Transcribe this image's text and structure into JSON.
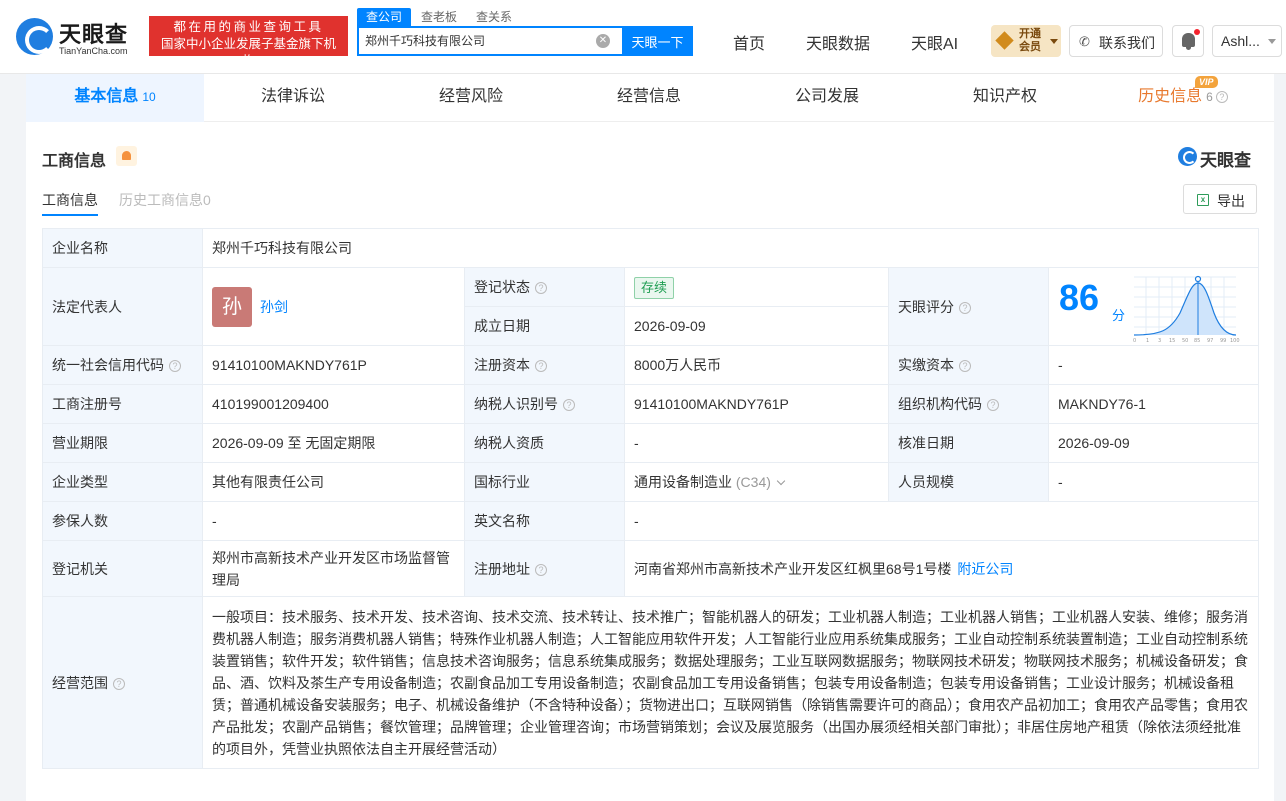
{
  "header": {
    "logo_name": "天眼查",
    "logo_url": "TianYanCha.com",
    "slogan_line1": "都在用的商业查询工具",
    "slogan_line2": "国家中小企业发展子基金旗下机构",
    "search_tabs": [
      "查公司",
      "查老板",
      "查关系"
    ],
    "search_value": "郑州千巧科技有限公司",
    "search_button": "天眼一下",
    "nav": [
      "首页",
      "天眼数据",
      "天眼AI"
    ],
    "vip_label": "开通会员",
    "contact_label": "联系我们",
    "user_name": "Ashl..."
  },
  "tabs": [
    {
      "label": "基本信息",
      "count": "10"
    },
    {
      "label": "法律诉讼"
    },
    {
      "label": "经营风险"
    },
    {
      "label": "经营信息"
    },
    {
      "label": "公司发展"
    },
    {
      "label": "知识产权"
    },
    {
      "label": "历史信息",
      "count": "6",
      "badge": "VIP"
    }
  ],
  "section": {
    "title": "工商信息",
    "brand": "天眼查",
    "sub_tabs": [
      "工商信息",
      "历史工商信息0"
    ],
    "export_label": "导出"
  },
  "info": {
    "company_name_label": "企业名称",
    "company_name": "郑州千巧科技有限公司",
    "legal_rep_label": "法定代表人",
    "legal_rep_avatar": "孙",
    "legal_rep": "孙剑",
    "reg_status_label": "登记状态",
    "reg_status": "存续",
    "founded_label": "成立日期",
    "founded": "2026-09-09",
    "score_label": "天眼评分",
    "score": "86",
    "score_unit": "分",
    "score_axis": [
      "0",
      "1",
      "3",
      "15",
      "50",
      "85",
      "97",
      "99",
      "100"
    ],
    "credit_code_label": "统一社会信用代码",
    "credit_code": "91410100MAKNDY761P",
    "reg_capital_label": "注册资本",
    "reg_capital": "8000万人民币",
    "paid_capital_label": "实缴资本",
    "paid_capital": "-",
    "reg_no_label": "工商注册号",
    "reg_no": "410199001209400",
    "taxpayer_id_label": "纳税人识别号",
    "taxpayer_id": "91410100MAKNDY761P",
    "org_code_label": "组织机构代码",
    "org_code": "MAKNDY76-1",
    "term_label": "营业期限",
    "term": "2026-09-09 至 无固定期限",
    "tax_qual_label": "纳税人资质",
    "tax_qual": "-",
    "approve_date_label": "核准日期",
    "approve_date": "2026-09-09",
    "type_label": "企业类型",
    "type": "其他有限责任公司",
    "industry_label": "国标行业",
    "industry": "通用设备制造业",
    "industry_code": "(C34)",
    "staff_label": "人员规模",
    "staff": "-",
    "insured_label": "参保人数",
    "insured": "-",
    "english_label": "英文名称",
    "english": "-",
    "authority_label": "登记机关",
    "authority": "郑州市高新技术产业开发区市场监督管理局",
    "address_label": "注册地址",
    "address": "河南省郑州市高新技术产业开发区红枫里68号1号楼",
    "nearby_label": "附近公司",
    "scope_label": "经营范围",
    "scope": "一般项目：技术服务、技术开发、技术咨询、技术交流、技术转让、技术推广；智能机器人的研发；工业机器人制造；工业机器人销售；工业机器人安装、维修；服务消费机器人制造；服务消费机器人销售；特殊作业机器人制造；人工智能应用软件开发；人工智能行业应用系统集成服务；工业自动控制系统装置制造；工业自动控制系统装置销售；软件开发；软件销售；信息技术咨询服务；信息系统集成服务；数据处理服务；工业互联网数据服务；物联网技术研发；物联网技术服务；机械设备研发；食品、酒、饮料及茶生产专用设备制造；农副食品加工专用设备制造；农副食品加工专用设备销售；包装专用设备制造；包装专用设备销售；工业设计服务；机械设备租赁；普通机械设备安装服务；电子、机械设备维护（不含特种设备）；货物进出口；互联网销售（除销售需要许可的商品）；食用农产品初加工；食用农产品零售；食用农产品批发；农副产品销售；餐饮管理；品牌管理；企业管理咨询；市场营销策划；会议及展览服务（出国办展须经相关部门审批）；非居住房地产租赁（除依法须经批准的项目外，凭营业执照依法自主开展经营活动）"
  }
}
